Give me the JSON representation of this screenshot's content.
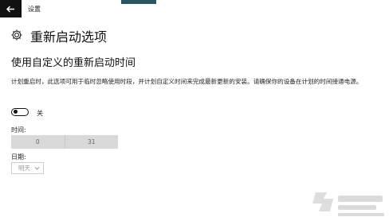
{
  "app": {
    "title": "设置"
  },
  "page": {
    "title": "重新启动选项"
  },
  "section": {
    "title": "使用自定义的重新启动时间",
    "description": "计划重启时，此选项可用于临时忽略使用时段，并计划自定义时间来完成最新更新的安装。请确保你的设备在计划的时间接通电源。"
  },
  "toggle": {
    "state_label": "关",
    "on": false
  },
  "time": {
    "label": "时间:",
    "hour": "0",
    "minute": "31"
  },
  "date": {
    "label": "日期:",
    "selected": "明天"
  },
  "colors": {
    "back_button_bg": "#111111",
    "picker_bg": "#d9d9d9",
    "text": "#111111"
  }
}
